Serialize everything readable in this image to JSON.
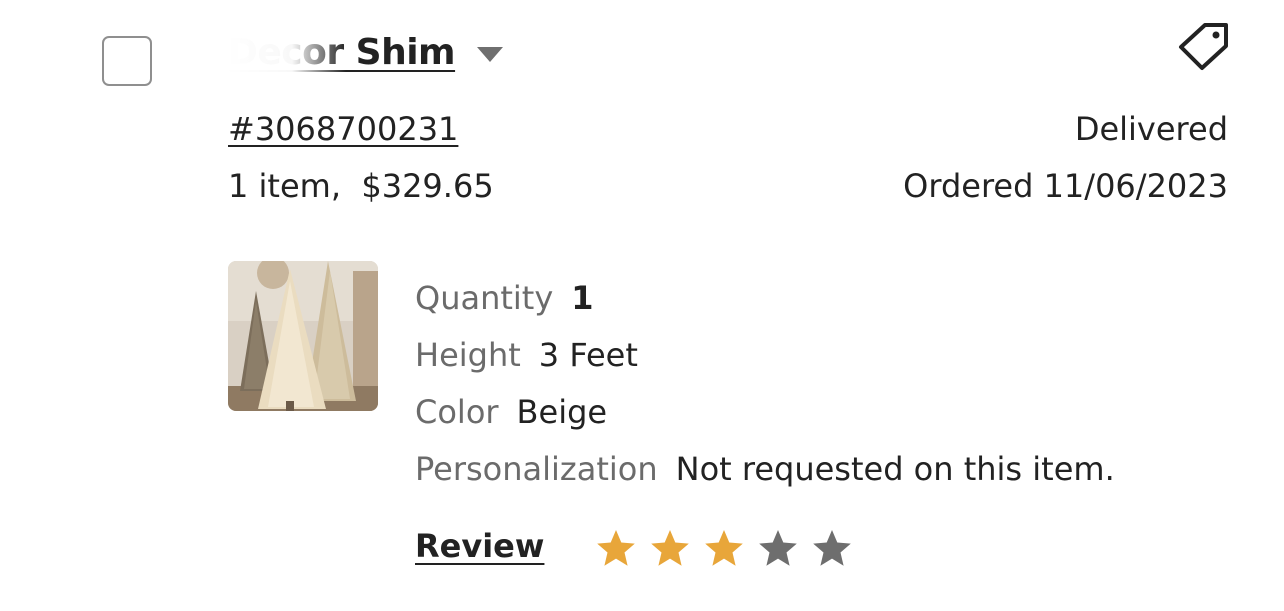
{
  "shop": {
    "name": "Decor Shim",
    "dropdown_icon": "caret-down-icon"
  },
  "header": {
    "tag_icon": "tag-icon"
  },
  "order": {
    "number": "#3068700231",
    "summary": "1 item,  $329.65",
    "status": "Delivered",
    "ordered_date": "Ordered 11/06/2023"
  },
  "item": {
    "thumbnail": "beige-christmas-tree-thumbnail",
    "details": [
      {
        "label": "Quantity",
        "value": "1"
      },
      {
        "label": "Height",
        "value": "3 Feet"
      },
      {
        "label": "Color",
        "value": "Beige"
      },
      {
        "label": "Personalization",
        "value": "Not requested on this item."
      }
    ]
  },
  "review": {
    "label": "Review",
    "rating": 3,
    "max_rating": 5,
    "star_filled_color": "#E8A63A",
    "star_empty_color": "#6E6E6E"
  }
}
